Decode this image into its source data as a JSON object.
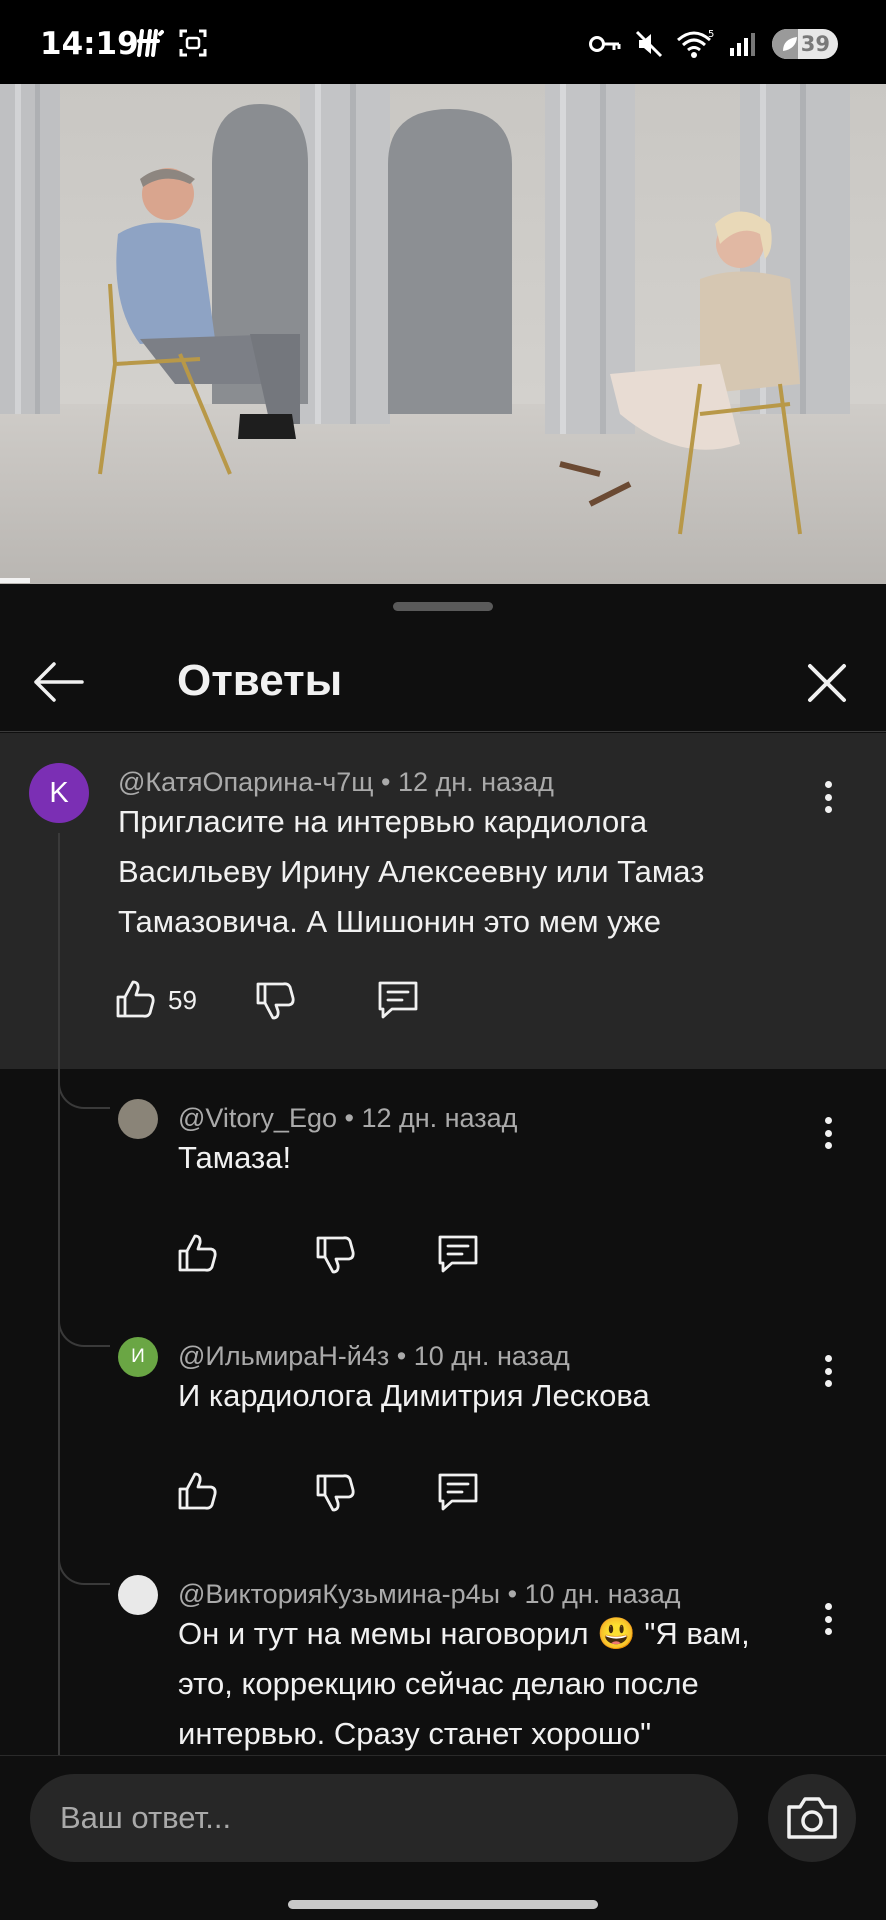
{
  "status_bar": {
    "time": "14:19",
    "battery_text": "39",
    "battery_level_percent": 39,
    "icons": [
      "h-icon",
      "screenshot-icon",
      "key-icon",
      "mute-icon",
      "wifi-icon",
      "signal-icon",
      "battery-icon"
    ]
  },
  "video": {
    "watched_fraction": 0.034
  },
  "sheet": {
    "title": "Ответы",
    "back_icon": "arrow-left-icon",
    "close_icon": "close-icon"
  },
  "parent_comment": {
    "avatar_letter": "K",
    "avatar_color": "#7b2fb4",
    "meta": "@КатяОпарина-ч7щ • 12 дн. назад",
    "lines": [
      "Пригласите на интервью кардиолога",
      "Васильеву Ирину Алексеевну или Тамаз",
      "Тамазовича. А Шишонин это мем уже"
    ],
    "like_count": "59"
  },
  "replies": [
    {
      "avatar_letter": "",
      "avatar_color": "#8a8478",
      "meta": "@Vitory_Ego • 12 дн. назад",
      "lines": [
        "Тамаза!"
      ]
    },
    {
      "avatar_letter": "И",
      "avatar_color": "#6aa644",
      "meta": "@ИльмираН-й4з • 10 дн. назад",
      "lines": [
        "И кардиолога Димитрия Лескова"
      ]
    },
    {
      "avatar_letter": "",
      "avatar_color": "#e9e9e9",
      "meta": "@ВикторияКузьмина-р4ы • 10 дн. назад",
      "lines": [
        "Он и тут на мемы наговорил 😃 \"Я вам,",
        "это, коррекцию сейчас делаю после",
        "интервью. Сразу станет хорошо\""
      ]
    }
  ],
  "reply_input": {
    "placeholder": "Ваш ответ..."
  },
  "colors": {
    "background": "#0f0f0f",
    "parent_highlight": "#272727",
    "meta_text": "#aaaaaa",
    "primary_text": "#f1f1f1"
  }
}
